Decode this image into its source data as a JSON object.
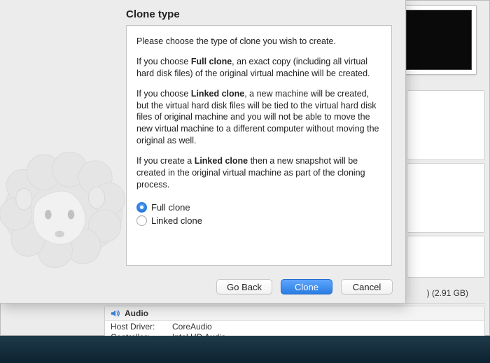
{
  "dialog": {
    "title": "Clone type",
    "intro": "Please choose the type of clone you wish to create.",
    "full_pre": "If you choose ",
    "full_bold": "Full clone",
    "full_post": ", an exact copy (including all virtual hard disk files) of the original virtual machine will be created.",
    "linked_pre": "If you choose ",
    "linked_bold": "Linked clone",
    "linked_post": ", a new machine will be created, but the virtual hard disk files will be tied to the virtual hard disk files of original machine and you will not be able to move the new virtual machine to a different computer without moving the original as well.",
    "snapshot_pre": "If you create a ",
    "snapshot_bold": "Linked clone",
    "snapshot_post": " then a new snapshot will be created in the original virtual machine as part of the cloning process.",
    "options": {
      "full": "Full clone",
      "linked": "Linked clone"
    },
    "buttons": {
      "back": "Go Back",
      "clone": "Clone",
      "cancel": "Cancel"
    }
  },
  "background": {
    "storage_size": ") (2.91 GB)",
    "audio_section": "Audio",
    "host_driver_label": "Host Driver:",
    "host_driver_value": "CoreAudio",
    "controller_label": "Controller:",
    "controller_value": "Intel HD Audio"
  }
}
